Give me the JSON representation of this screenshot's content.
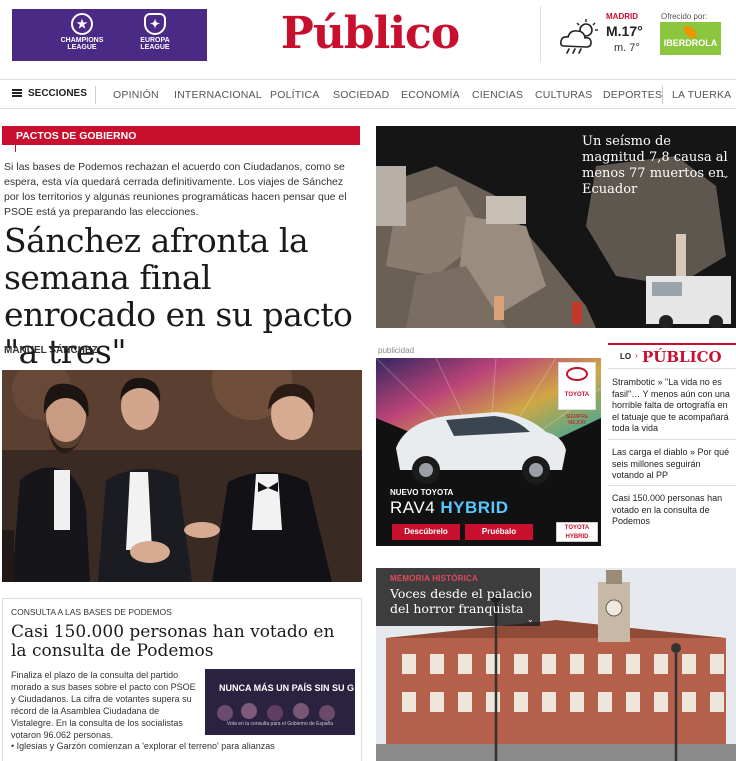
{
  "header": {
    "banner": {
      "champions": "CHAMPIONS LEAGUE",
      "europa": "EUROPA LEAGUE"
    },
    "logo": "Público",
    "weather": {
      "city": "MADRID",
      "max": "M.17°",
      "min": "m. 7°"
    },
    "sponsor": {
      "label": "Ofrecido por:",
      "name": "IBERDROLA"
    }
  },
  "nav": {
    "menu_label": "SECCIONES",
    "items": [
      "OPINIÓN",
      "INTERNACIONAL",
      "POLÍTICA",
      "SOCIEDAD",
      "ECONOMÍA",
      "CIENCIAS",
      "CULTURAS",
      "DEPORTES",
      "LA TUERKA"
    ]
  },
  "lead": {
    "tag": "PACTOS DE GOBIERNO",
    "summary": "Si las bases de Podemos rechazan el acuerdo con Ciudadanos, como se espera, esta vía quedará cerrada definitivamente. Los viajes de Sánchez por los territorios y algunas reuniones programáticas hacen pensar que el PSOE está ya preparando las elecciones.",
    "headline": "Sánchez afronta la semana final enrocado en su pacto \"a tres\"",
    "author": "MANUEL SÁNCHEZ"
  },
  "podemos_box": {
    "tag": "CONSULTA A LAS BASES DE PODEMOS",
    "title": "Casi 150.000 personas han votado en la consulta de Podemos",
    "text": "Finaliza el plazo de la consulta del partido morado a sus bases sobre el pacto con PSOE y Ciudadanos. La cifra de votantes supera su récord de la Asamblea Ciudadana de Vistalegre. En la consulta de los socialistas votaron 96.062 personas.",
    "image_text": "NUNCA MÁS UN PAÍS SIN SU G",
    "image_caption": "Vota en la consulta para el Gobierno de España",
    "related": "Iglesias y Garzón comienzan a 'explorar el terreno' para alianzas"
  },
  "quake": {
    "title": "Un seísmo de magnitud 7,8 causa al menos 77 muertos en Ecuador"
  },
  "ad": {
    "label": "publicidad",
    "brand": "TOYOTA",
    "slogan": "SIEMPRE MEJOR",
    "nuevo": "NUEVO TOYOTA",
    "model": "RAV4",
    "model_suffix": "HYBRID",
    "btn_discover": "Descúbrelo",
    "btn_try": "Pruébalo",
    "badge": "TOYOTA HYBRID"
  },
  "lo_mas": {
    "prefix": "LO",
    "logo": "PÚBLICO",
    "items": [
      "Strambotic » \"La vida no es fasil\"… Y menos aún con una horrible falta de ortografía en el tatuaje que te acompañará toda la vida",
      "Las carga el diablo » Por qué seis millones seguirán votando al PP",
      "Casi 150.000 personas han votado en la consulta de Podemos"
    ]
  },
  "memoria": {
    "tag": "MEMORIA HISTÓRICA",
    "title": "Voces desde el palacio del horror franquista"
  },
  "colors": {
    "brand": "#c8102e",
    "uefa": "#4b2a86",
    "iberdrola": "#8cc63f"
  }
}
